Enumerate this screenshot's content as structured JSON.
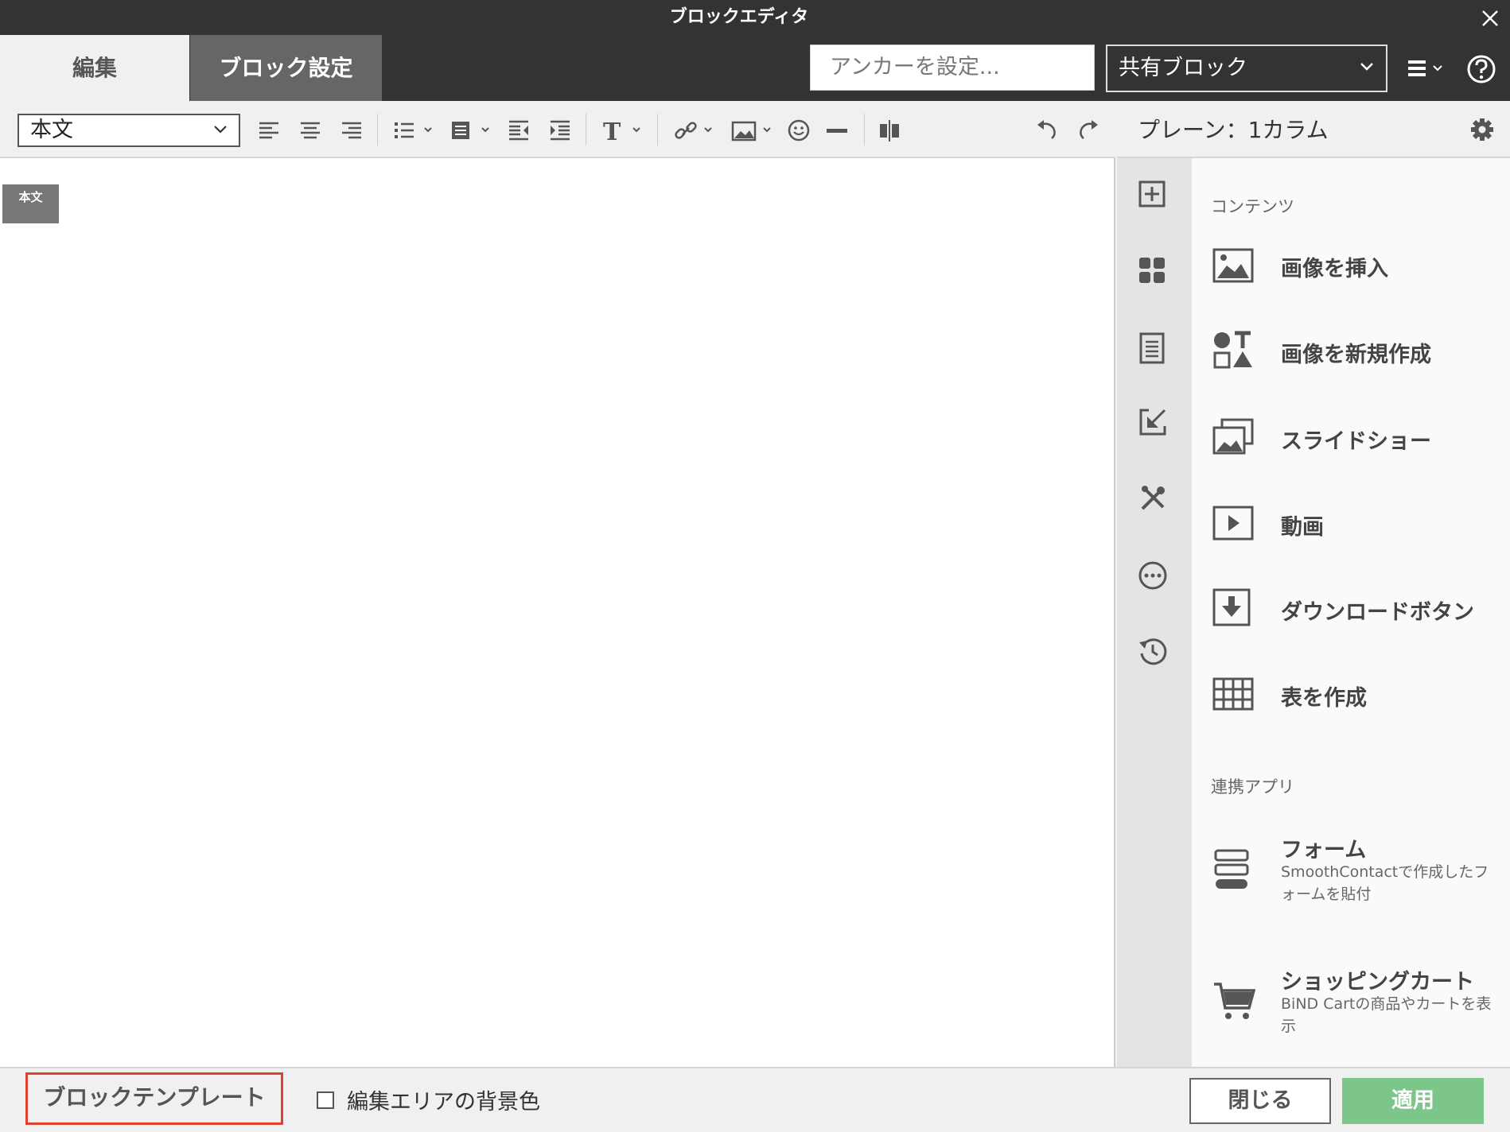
{
  "window": {
    "title": "ブロックエディタ"
  },
  "tabs": [
    {
      "label": "編集"
    },
    {
      "label": "ブロック設定"
    }
  ],
  "anchor": {
    "placeholder": "アンカーを設定..."
  },
  "shared_block": {
    "value": "共有ブロック"
  },
  "toolbar": {
    "style_select": "本文",
    "icons": [
      "align-left-icon",
      "align-center-icon",
      "align-right-icon",
      "list-icon",
      "block-format-icon",
      "outdent-icon",
      "indent-icon",
      "text-style-icon",
      "link-icon",
      "image-icon",
      "emoji-icon",
      "horizontal-rule-icon",
      "column-split-icon",
      "undo-icon",
      "redo-icon"
    ]
  },
  "canvas": {
    "paragraph_tag": "本文"
  },
  "panel": {
    "title": "プレーン：1カラム",
    "side_icons": [
      "add-block-icon",
      "parts-icon",
      "page-icon",
      "import-icon",
      "tools-icon",
      "more-icon",
      "history-icon"
    ],
    "contents_heading": "コンテンツ",
    "contents": [
      {
        "label": "画像を挿入",
        "icon": "image-icon"
      },
      {
        "label": "画像を新規作成",
        "icon": "shapes-icon"
      },
      {
        "label": "スライドショー",
        "icon": "slideshow-icon"
      },
      {
        "label": "動画",
        "icon": "video-icon"
      },
      {
        "label": "ダウンロードボタン",
        "icon": "download-icon"
      },
      {
        "label": "表を作成",
        "icon": "table-icon"
      }
    ],
    "apps_heading": "連携アプリ",
    "apps": [
      {
        "label": "フォーム",
        "desc": "SmoothContactで作成したフォームを貼付",
        "icon": "form-icon"
      },
      {
        "label": "ショッピングカート",
        "desc": "BiND Cartの商品やカートを表示",
        "icon": "cart-icon"
      }
    ]
  },
  "footer": {
    "template_button": "ブロックテンプレート",
    "bg_checkbox_label": "編集エリアの背景色",
    "close_button": "閉じる",
    "apply_button": "適用"
  },
  "colors": {
    "dark_bar": "#333333",
    "apply": "#7cc68a",
    "highlight": "#e04030"
  }
}
